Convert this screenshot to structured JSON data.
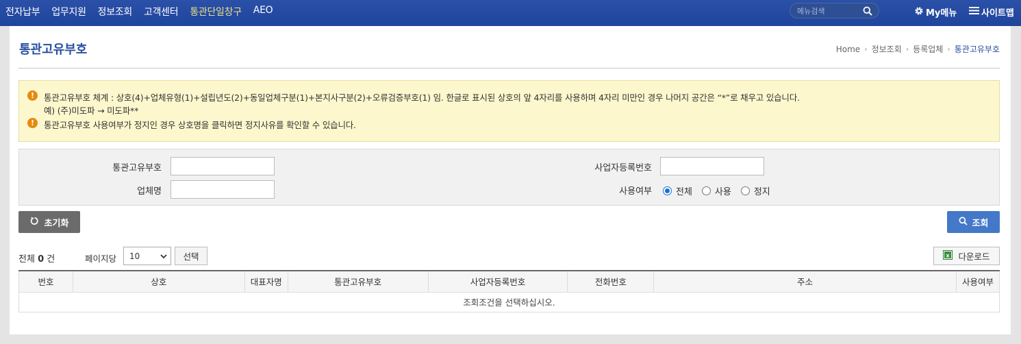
{
  "nav": {
    "items": [
      "전자납부",
      "업무지원",
      "정보조회",
      "고객센터",
      "통관단일창구",
      "AEO"
    ],
    "active_index": 4,
    "search_placeholder": "메뉴검색",
    "mymenu": "My메뉴",
    "sitemap": "사이트맵"
  },
  "page": {
    "title": "통관고유부호",
    "breadcrumb": [
      "Home",
      "정보조회",
      "등록업체",
      "통관고유부호"
    ]
  },
  "notice": {
    "line1": "통관고유부호 체계 : 상호(4)+업체유형(1)+설립년도(2)+동일업체구분(1)+본지사구분(2)+오류검증부호(1) 임. 한글로 표시된 상호의 앞 4자리를 사용하며 4자리 미만인 경우 나머지 공간은 “*”로 채우고 있습니다.",
    "line1b": "예) (주)미도파 → 미도파**",
    "line2": "통관고유부호 사용여부가 정지인 경우 상호명을 클릭하면 정지사유를 확인할 수 있습니다."
  },
  "form": {
    "customs_code_label": "통관고유부호",
    "customs_code_value": "",
    "company_name_label": "업체명",
    "company_name_value": "",
    "biz_reg_label": "사업자등록번호",
    "biz_reg_value": "",
    "usage_label": "사용여부",
    "usage_options": [
      "전체",
      "사용",
      "정지"
    ],
    "usage_selected": "전체"
  },
  "buttons": {
    "reset": "초기화",
    "search": "조회",
    "select": "선택",
    "download": "다운로드"
  },
  "results": {
    "total_prefix": "전체",
    "total_count": "0",
    "total_suffix": "건",
    "per_page_label": "페이지당",
    "per_page_value": "10",
    "columns": [
      "번호",
      "상호",
      "대표자명",
      "통관고유부호",
      "사업자등록번호",
      "전화번호",
      "주소",
      "사용여부"
    ],
    "empty_message": "조회조건을 선택하십시오."
  },
  "colors": {
    "nav_bg": "#2348a0",
    "nav_active": "#e9e08a",
    "title": "#2a4fa0",
    "notice_bg": "#fdf7cd",
    "notice_icon": "#e48a10",
    "reset_btn": "#6b6b6b",
    "search_btn": "#4478c8"
  },
  "icons": {
    "search": "search-icon",
    "gear": "gear-icon",
    "hamburger": "hamburger-icon",
    "reset": "refresh-icon",
    "excel": "excel-icon",
    "notice": "exclamation-icon"
  }
}
